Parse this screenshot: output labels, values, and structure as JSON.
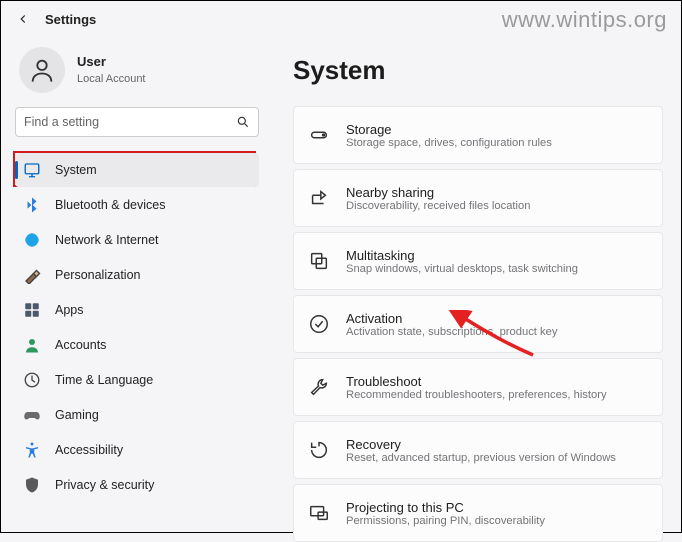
{
  "watermark": "www.wintips.org",
  "header": {
    "title": "Settings"
  },
  "user": {
    "name": "User",
    "account_type": "Local Account"
  },
  "search": {
    "placeholder": "Find a setting"
  },
  "sidebar": {
    "items": [
      {
        "label": "System"
      },
      {
        "label": "Bluetooth & devices"
      },
      {
        "label": "Network & Internet"
      },
      {
        "label": "Personalization"
      },
      {
        "label": "Apps"
      },
      {
        "label": "Accounts"
      },
      {
        "label": "Time & Language"
      },
      {
        "label": "Gaming"
      },
      {
        "label": "Accessibility"
      },
      {
        "label": "Privacy & security"
      }
    ]
  },
  "main": {
    "title": "System",
    "cards": [
      {
        "title": "Storage",
        "subtitle": "Storage space, drives, configuration rules"
      },
      {
        "title": "Nearby sharing",
        "subtitle": "Discoverability, received files location"
      },
      {
        "title": "Multitasking",
        "subtitle": "Snap windows, virtual desktops, task switching"
      },
      {
        "title": "Activation",
        "subtitle": "Activation state, subscriptions, product key"
      },
      {
        "title": "Troubleshoot",
        "subtitle": "Recommended troubleshooters, preferences, history"
      },
      {
        "title": "Recovery",
        "subtitle": "Reset, advanced startup, previous version of Windows"
      },
      {
        "title": "Projecting to this PC",
        "subtitle": "Permissions, pairing PIN, discoverability"
      }
    ]
  },
  "colors": {
    "accent": "#0067c0",
    "annotate": "#e52020"
  }
}
